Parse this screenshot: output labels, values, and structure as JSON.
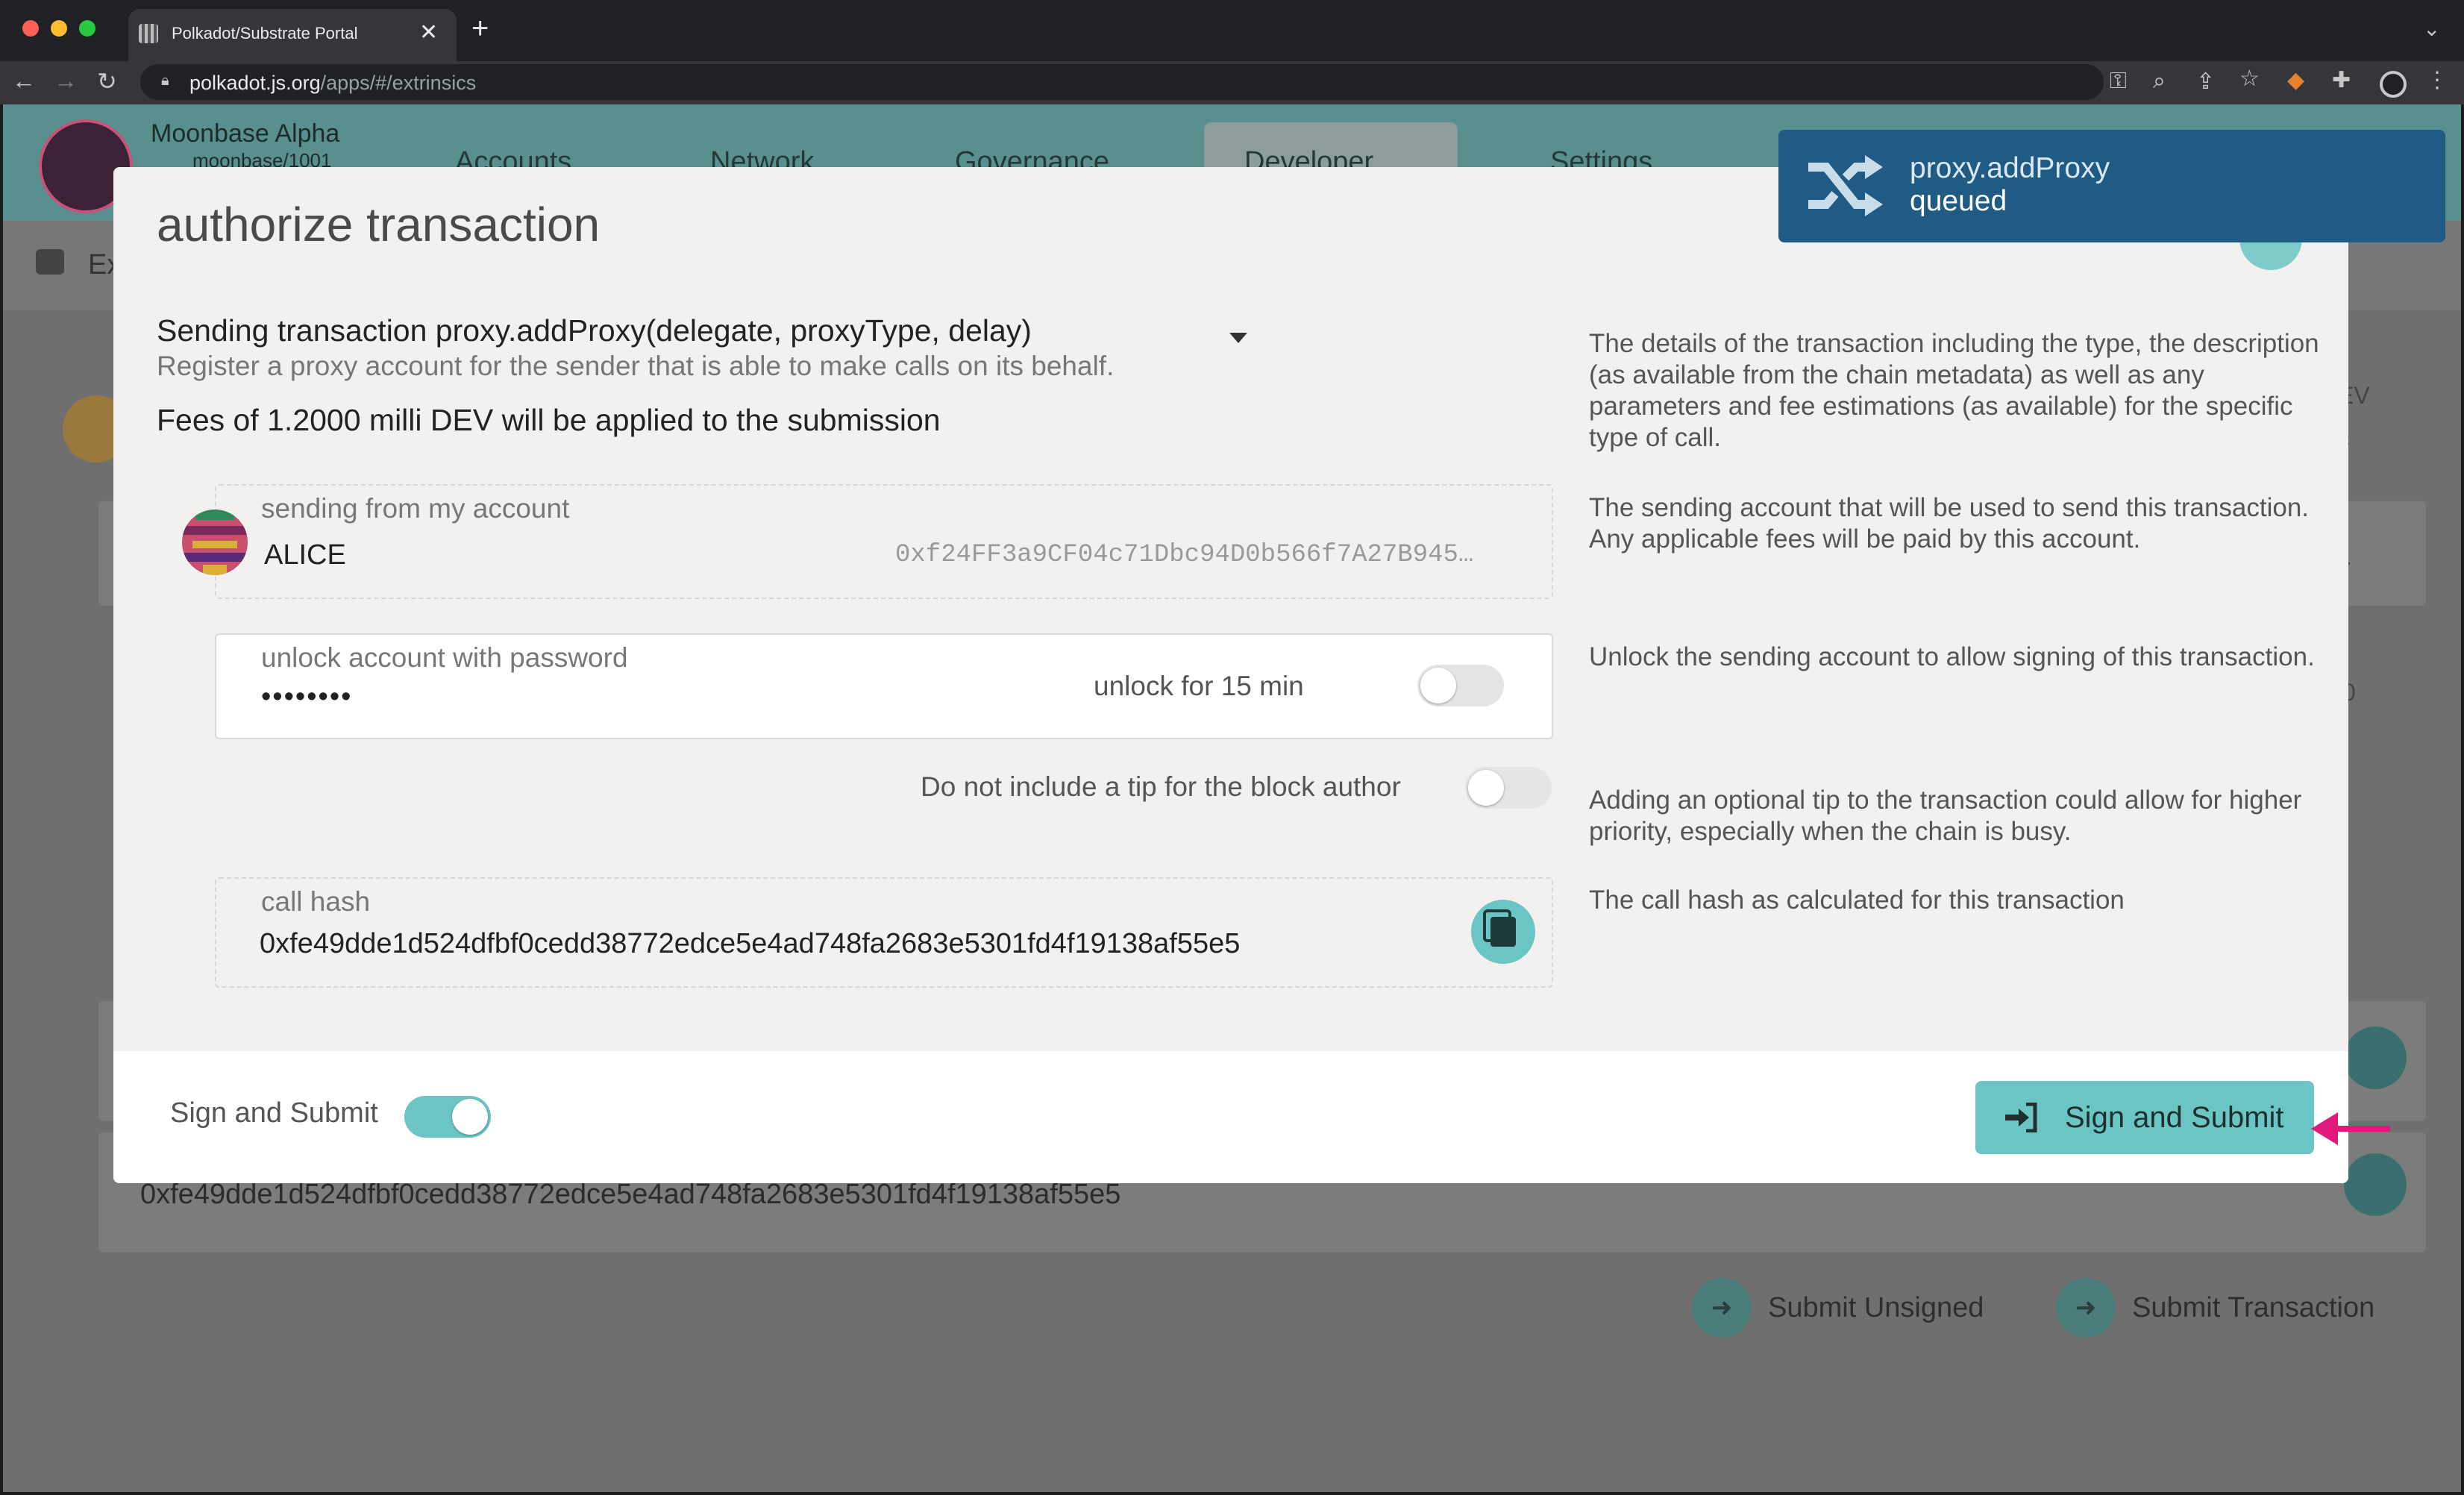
{
  "browser": {
    "tab_title": "Polkadot/Substrate Portal",
    "url_host": "polkadot.js.org",
    "url_path": "/apps/#/extrinsics"
  },
  "app": {
    "chain_name": "Moonbase Alpha",
    "chain_sub": "moonbase/1001",
    "menu": [
      "Accounts",
      "Network",
      "Governance",
      "Developer",
      "Settings"
    ],
    "sub_tab": "Ex",
    "bg_call_hash": "0xfe49dde1d524dfbf0cedd38772edce5e4ad748fa2683e5301fd4f19138af55e5",
    "bg_right_texts": [
      "EV",
      "c",
      ".",
      "0"
    ],
    "submit_unsigned": "Submit Unsigned",
    "submit_transaction": "Submit Transaction"
  },
  "modal": {
    "title": "authorize transaction",
    "tx_header": "Sending transaction proxy.addProxy(delegate, proxyType, delay)",
    "tx_description": "Register a proxy account for the sender that is able to make calls on its behalf.",
    "fees": "Fees of 1.2000 milli DEV will be applied to the submission",
    "help": {
      "tx": "The details of the transaction including the type, the description (as available from the chain metadata) as well as any parameters and fee estimations (as available) for the specific type of call.",
      "account": "The sending account that will be used to send this transaction. Any applicable fees will be paid by this account.",
      "unlock": "Unlock the sending account to allow signing of this transaction.",
      "tip": "Adding an optional tip to the transaction could allow for higher priority, especially when the chain is busy.",
      "hash": "The call hash as calculated for this transaction"
    },
    "account": {
      "label": "sending from my account",
      "name": "ALICE",
      "address": "0xf24FF3a9CF04c71Dbc94D0b566f7A27B945…"
    },
    "unlock": {
      "label": "unlock account with password",
      "password_mask": "••••••••",
      "toggle_label": "unlock for 15 min",
      "toggle_on": false
    },
    "tip": {
      "label": "Do not include a tip for the block author",
      "toggle_on": false
    },
    "call_hash": {
      "label": "call hash",
      "value": "0xfe49dde1d524dfbf0cedd38772edce5e4ad748fa2683e5301fd4f19138af55e5"
    },
    "footer": {
      "toggle_label": "Sign and Submit",
      "toggle_on": true,
      "button_label": "Sign and Submit"
    }
  },
  "toast": {
    "title": "proxy.addProxy",
    "status": "queued"
  },
  "colors": {
    "accent": "#6cc5c5",
    "toast": "#1f5b84",
    "annotation_arrow": "#e0197d"
  },
  "icons": [
    "back-icon",
    "forward-icon",
    "reload-icon",
    "lock-icon",
    "key-icon",
    "zoom-icon",
    "share-icon",
    "star-icon",
    "metamask-icon",
    "puzzle-icon",
    "profile-icon",
    "kebab-icon",
    "shuffle-icon",
    "copy-icon",
    "sign-in-icon"
  ]
}
